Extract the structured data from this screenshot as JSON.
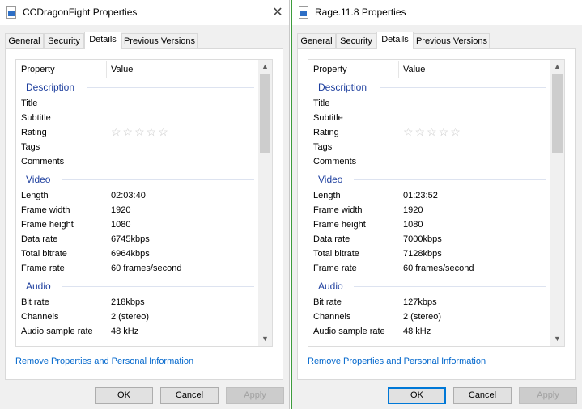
{
  "windows": [
    {
      "title": "CCDragonFight Properties",
      "tabs": [
        "General",
        "Security",
        "Details",
        "Previous Versions"
      ],
      "active_tab": "Details",
      "columns": {
        "property": "Property",
        "value": "Value"
      },
      "sections": {
        "description": "Description",
        "video": "Video",
        "audio": "Audio"
      },
      "description": {
        "title_label": "Title",
        "title_value": "",
        "subtitle_label": "Subtitle",
        "subtitle_value": "",
        "rating_label": "Rating",
        "rating_stars": "☆☆☆☆☆",
        "tags_label": "Tags",
        "tags_value": "",
        "comments_label": "Comments",
        "comments_value": ""
      },
      "video": {
        "length_label": "Length",
        "length_value": "02:03:40",
        "frame_width_label": "Frame width",
        "frame_width_value": "1920",
        "frame_height_label": "Frame height",
        "frame_height_value": "1080",
        "data_rate_label": "Data rate",
        "data_rate_value": "6745kbps",
        "total_bitrate_label": "Total bitrate",
        "total_bitrate_value": "6964kbps",
        "frame_rate_label": "Frame rate",
        "frame_rate_value": "60 frames/second"
      },
      "audio": {
        "bit_rate_label": "Bit rate",
        "bit_rate_value": "218kbps",
        "channels_label": "Channels",
        "channels_value": "2 (stereo)",
        "sample_rate_label": "Audio sample rate",
        "sample_rate_value": "48 kHz"
      },
      "remove_link": "Remove Properties and Personal Information",
      "buttons": {
        "ok": "OK",
        "cancel": "Cancel",
        "apply": "Apply"
      },
      "close_glyph": "✕"
    },
    {
      "title": "Rage.11.8 Properties",
      "tabs": [
        "General",
        "Security",
        "Details",
        "Previous Versions"
      ],
      "active_tab": "Details",
      "columns": {
        "property": "Property",
        "value": "Value"
      },
      "sections": {
        "description": "Description",
        "video": "Video",
        "audio": "Audio"
      },
      "description": {
        "title_label": "Title",
        "title_value": "",
        "subtitle_label": "Subtitle",
        "subtitle_value": "",
        "rating_label": "Rating",
        "rating_stars": "☆☆☆☆☆",
        "tags_label": "Tags",
        "tags_value": "",
        "comments_label": "Comments",
        "comments_value": ""
      },
      "video": {
        "length_label": "Length",
        "length_value": "01:23:52",
        "frame_width_label": "Frame width",
        "frame_width_value": "1920",
        "frame_height_label": "Frame height",
        "frame_height_value": "1080",
        "data_rate_label": "Data rate",
        "data_rate_value": "7000kbps",
        "total_bitrate_label": "Total bitrate",
        "total_bitrate_value": "7128kbps",
        "frame_rate_label": "Frame rate",
        "frame_rate_value": "60 frames/second"
      },
      "audio": {
        "bit_rate_label": "Bit rate",
        "bit_rate_value": "127kbps",
        "channels_label": "Channels",
        "channels_value": "2 (stereo)",
        "sample_rate_label": "Audio sample rate",
        "sample_rate_value": "48 kHz"
      },
      "remove_link": "Remove Properties and Personal Information",
      "buttons": {
        "ok": "OK",
        "cancel": "Cancel",
        "apply": "Apply"
      },
      "close_glyph": ""
    }
  ],
  "colors": {
    "link": "#0066cc",
    "section_heading": "#1e3f9e",
    "focus_border": "#3c9c3c"
  },
  "icons": {
    "file_icon": "video-file-icon",
    "rating": "star-outline-icon",
    "scroll_up": "chevron-up-icon",
    "scroll_down": "chevron-down-icon"
  }
}
